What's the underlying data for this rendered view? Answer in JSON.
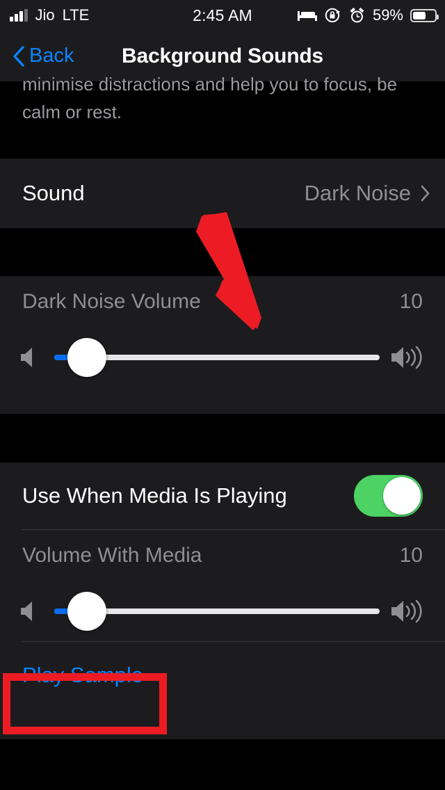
{
  "status_bar": {
    "carrier": "Jio",
    "network": "LTE",
    "time": "2:45 AM",
    "battery_percent": "59%",
    "icons": [
      "signal-bars-icon",
      "bed-icon",
      "rotation-lock-icon",
      "alarm-clock-icon",
      "battery-icon"
    ]
  },
  "nav": {
    "back_label": "Back",
    "title": "Background Sounds",
    "back_icon": "chevron-left-icon",
    "accent_color": "#0a84ff"
  },
  "footer_note": {
    "line1": "minimise distractions and help you to focus, be",
    "line2": "calm or rest."
  },
  "sound_row": {
    "label": "Sound",
    "value": "Dark Noise",
    "disclosure_icon": "chevron-right-icon"
  },
  "noise_volume": {
    "label": "Dark Noise Volume",
    "value": "10",
    "fill_percent": 10,
    "low_icon": "speaker-low-icon",
    "high_icon": "speaker-high-icon",
    "fill_color": "#0a6cf0"
  },
  "media_section": {
    "toggle": {
      "label": "Use When Media Is Playing",
      "state": "on",
      "on_color": "#4cd364"
    },
    "volume": {
      "label": "Volume With Media",
      "value": "10",
      "fill_percent": 10,
      "low_icon": "speaker-low-icon",
      "high_icon": "speaker-high-icon"
    },
    "play_sample": {
      "label": "Play Sample"
    }
  },
  "annotations": {
    "arrow": {
      "shape": "down-right-arrow",
      "color": "#ed1c24"
    },
    "highlight_box": {
      "target": "Play Sample",
      "color": "#ed1c24"
    }
  }
}
